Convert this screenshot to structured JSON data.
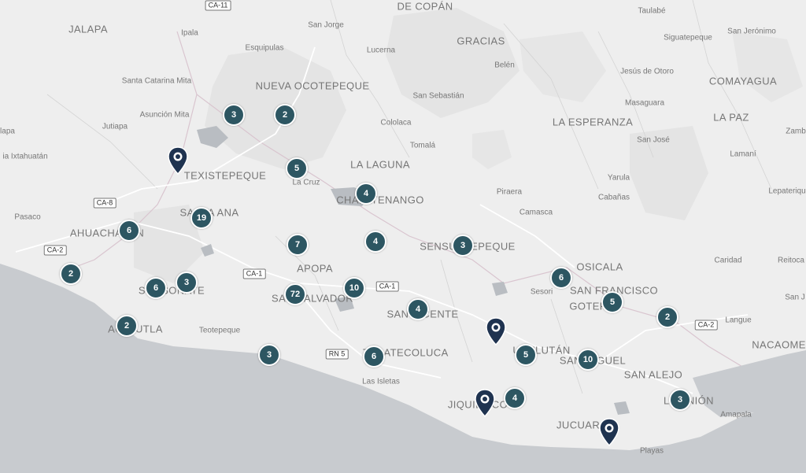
{
  "colors": {
    "land": "#eeeeee",
    "sea": "#c8cbcf",
    "cluster": "#2d5662",
    "pin": "#1f3350",
    "terrain": "#dcdcdc"
  },
  "labels": [
    {
      "id": "jalapa",
      "text": "JALAPA",
      "kind": "dept"
    },
    {
      "id": "ipala",
      "text": "Ipala",
      "kind": "town"
    },
    {
      "id": "san-jorge",
      "text": "San Jorge",
      "kind": "town"
    },
    {
      "id": "gracias",
      "text": "GRACIAS",
      "kind": "dept"
    },
    {
      "id": "taulabe",
      "text": "Taulabé",
      "kind": "town"
    },
    {
      "id": "siguatepeque",
      "text": "Siguatepeque",
      "kind": "town"
    },
    {
      "id": "san-jeronimo",
      "text": "San Jerónimo",
      "kind": "town"
    },
    {
      "id": "esquipulas",
      "text": "Esquipulas",
      "kind": "town"
    },
    {
      "id": "lucerna",
      "text": "Lucerna",
      "kind": "town"
    },
    {
      "id": "belen",
      "text": "Belén",
      "kind": "town"
    },
    {
      "id": "jesus-de-otoro",
      "text": "Jesús de Otoro",
      "kind": "town"
    },
    {
      "id": "comayagua",
      "text": "COMAYAGUA",
      "kind": "dept"
    },
    {
      "id": "santa-catarina-mita",
      "text": "Santa Catarina Mita",
      "kind": "town"
    },
    {
      "id": "nueva-ocotepeque",
      "text": "NUEVA OCOTEPEQUE",
      "kind": "dept"
    },
    {
      "id": "san-sebastian",
      "text": "San Sebastián",
      "kind": "town"
    },
    {
      "id": "masaguara",
      "text": "Masaguara",
      "kind": "town"
    },
    {
      "id": "asuncion-mita",
      "text": "Asunción Mita",
      "kind": "town"
    },
    {
      "id": "cololaca",
      "text": "Cololaca",
      "kind": "town"
    },
    {
      "id": "la-esperanza",
      "text": "LA ESPERANZA",
      "kind": "dept"
    },
    {
      "id": "la-paz",
      "text": "LA PAZ",
      "kind": "dept"
    },
    {
      "id": "jutiapa",
      "text": "Jutiapa",
      "kind": "town"
    },
    {
      "id": "zamb",
      "text": "Zamb",
      "kind": "town"
    },
    {
      "id": "tomala",
      "text": "Tomalá",
      "kind": "town"
    },
    {
      "id": "san-jose",
      "text": "San José",
      "kind": "town"
    },
    {
      "id": "ixtahuatan",
      "text": "ia Ixtahuatán",
      "kind": "town"
    },
    {
      "id": "lamani",
      "text": "Lamaní",
      "kind": "town"
    },
    {
      "id": "la-laguna",
      "text": "LA LAGUNA",
      "kind": "dept"
    },
    {
      "id": "texistepeque",
      "text": "TEXISTEPEQUE",
      "kind": "dept"
    },
    {
      "id": "la-cruz",
      "text": "La Cruz",
      "kind": "town"
    },
    {
      "id": "yarula",
      "text": "Yarula",
      "kind": "town"
    },
    {
      "id": "piraera",
      "text": "Piraera",
      "kind": "town"
    },
    {
      "id": "lepaterique",
      "text": "Lepateriqu",
      "kind": "town"
    },
    {
      "id": "chalatenango",
      "text": "CHALATENANGO",
      "kind": "dept"
    },
    {
      "id": "cabanas",
      "text": "Cabañas",
      "kind": "town"
    },
    {
      "id": "pasaco",
      "text": "Pasaco",
      "kind": "town"
    },
    {
      "id": "santa-ana",
      "text": "SANTA ANA",
      "kind": "dept"
    },
    {
      "id": "camasca",
      "text": "Camasca",
      "kind": "town"
    },
    {
      "id": "ahuachapan",
      "text": "AHUACHAPÁN",
      "kind": "dept"
    },
    {
      "id": "sensuntepeque",
      "text": "SENSUNTEPEQUE",
      "kind": "dept"
    },
    {
      "id": "caridad",
      "text": "Caridad",
      "kind": "town"
    },
    {
      "id": "reitoca",
      "text": "Reitoca",
      "kind": "town"
    },
    {
      "id": "apopa",
      "text": "APOPA",
      "kind": "dept"
    },
    {
      "id": "osicala",
      "text": "OSICALA",
      "kind": "dept"
    },
    {
      "id": "sonsonate",
      "text": "SONSONATE",
      "kind": "dept"
    },
    {
      "id": "san-salvador",
      "text": "SAN SALVADOR",
      "kind": "dept"
    },
    {
      "id": "sesori",
      "text": "Sesori",
      "kind": "town"
    },
    {
      "id": "san-francisco-gotera",
      "text": "SAN FRANCISCO",
      "kind": "dept"
    },
    {
      "id": "gotera",
      "text": "GOTERA",
      "kind": "dept"
    },
    {
      "id": "san-vicente",
      "text": "SAN VICENTE",
      "kind": "dept"
    },
    {
      "id": "langue",
      "text": "Langue",
      "kind": "town"
    },
    {
      "id": "acajutla",
      "text": "ACAJUTLA",
      "kind": "dept"
    },
    {
      "id": "teotepeque",
      "text": "Teotepeque",
      "kind": "town"
    },
    {
      "id": "nacaome",
      "text": "NACAOME",
      "kind": "dept"
    },
    {
      "id": "zacatecoluca",
      "text": "ZACATECOLUCA",
      "kind": "dept"
    },
    {
      "id": "usulutan",
      "text": "USULUTÁN",
      "kind": "dept"
    },
    {
      "id": "san-miguel",
      "text": "SAN MIGUEL",
      "kind": "dept"
    },
    {
      "id": "san-alejo",
      "text": "SAN ALEJO",
      "kind": "dept"
    },
    {
      "id": "las-isletas",
      "text": "Las Isletas",
      "kind": "town"
    },
    {
      "id": "jiquilisco",
      "text": "JIQUILISCO",
      "kind": "dept"
    },
    {
      "id": "la-union",
      "text": "LA UNIÓN",
      "kind": "dept"
    },
    {
      "id": "amapala",
      "text": "Amapala",
      "kind": "town"
    },
    {
      "id": "jucuaran",
      "text": "JUCUARÁN",
      "kind": "dept"
    },
    {
      "id": "playas",
      "text": "Playas",
      "kind": "town"
    },
    {
      "id": "copan",
      "text": "DE COPÁN",
      "kind": "dept"
    },
    {
      "id": "lapa",
      "text": "lapa",
      "kind": "town"
    },
    {
      "id": "san-jose-ps",
      "text": "San J",
      "kind": "town"
    }
  ],
  "shields": [
    {
      "id": "ca11",
      "text": "CA-11"
    },
    {
      "id": "ca8",
      "text": "CA-8"
    },
    {
      "id": "ca2-west",
      "text": "CA-2"
    },
    {
      "id": "ca1-a",
      "text": "CA-1"
    },
    {
      "id": "ca1-b",
      "text": "CA-1"
    },
    {
      "id": "rn5",
      "text": "RN 5"
    },
    {
      "id": "ca2-east",
      "text": "CA-2"
    }
  ],
  "clusters": [
    {
      "id": "ocotepeque-w",
      "count": "3"
    },
    {
      "id": "ocotepeque-e",
      "count": "2"
    },
    {
      "id": "la-palma",
      "count": "5"
    },
    {
      "id": "chalatenango",
      "count": "4"
    },
    {
      "id": "ahuachapan",
      "count": "6"
    },
    {
      "id": "santa-ana",
      "count": "19"
    },
    {
      "id": "cuscatlan",
      "count": "4"
    },
    {
      "id": "sensuntepeque",
      "count": "3"
    },
    {
      "id": "apopa",
      "count": "7"
    },
    {
      "id": "osicala",
      "count": "6"
    },
    {
      "id": "west-coast",
      "count": "2"
    },
    {
      "id": "sonsonate",
      "count": "6"
    },
    {
      "id": "izalco",
      "count": "3"
    },
    {
      "id": "san-salvador",
      "count": "72"
    },
    {
      "id": "ilopango",
      "count": "10"
    },
    {
      "id": "gotera",
      "count": "5"
    },
    {
      "id": "san-vicente",
      "count": "4"
    },
    {
      "id": "la-union-n",
      "count": "2"
    },
    {
      "id": "acajutla",
      "count": "2"
    },
    {
      "id": "la-libertad",
      "count": "3"
    },
    {
      "id": "zacatecoluca",
      "count": "6"
    },
    {
      "id": "usulutan",
      "count": "5"
    },
    {
      "id": "san-miguel",
      "count": "10"
    },
    {
      "id": "jiquilisco",
      "count": "4"
    },
    {
      "id": "la-union",
      "count": "3"
    }
  ],
  "pins": [
    {
      "id": "texistepeque-pin",
      "icon": "map-pin-icon"
    },
    {
      "id": "san-vicente-pin",
      "icon": "map-pin-icon"
    },
    {
      "id": "jiquilisco-pin",
      "icon": "map-pin-icon"
    },
    {
      "id": "jucuaran-pin",
      "icon": "map-pin-icon"
    }
  ]
}
